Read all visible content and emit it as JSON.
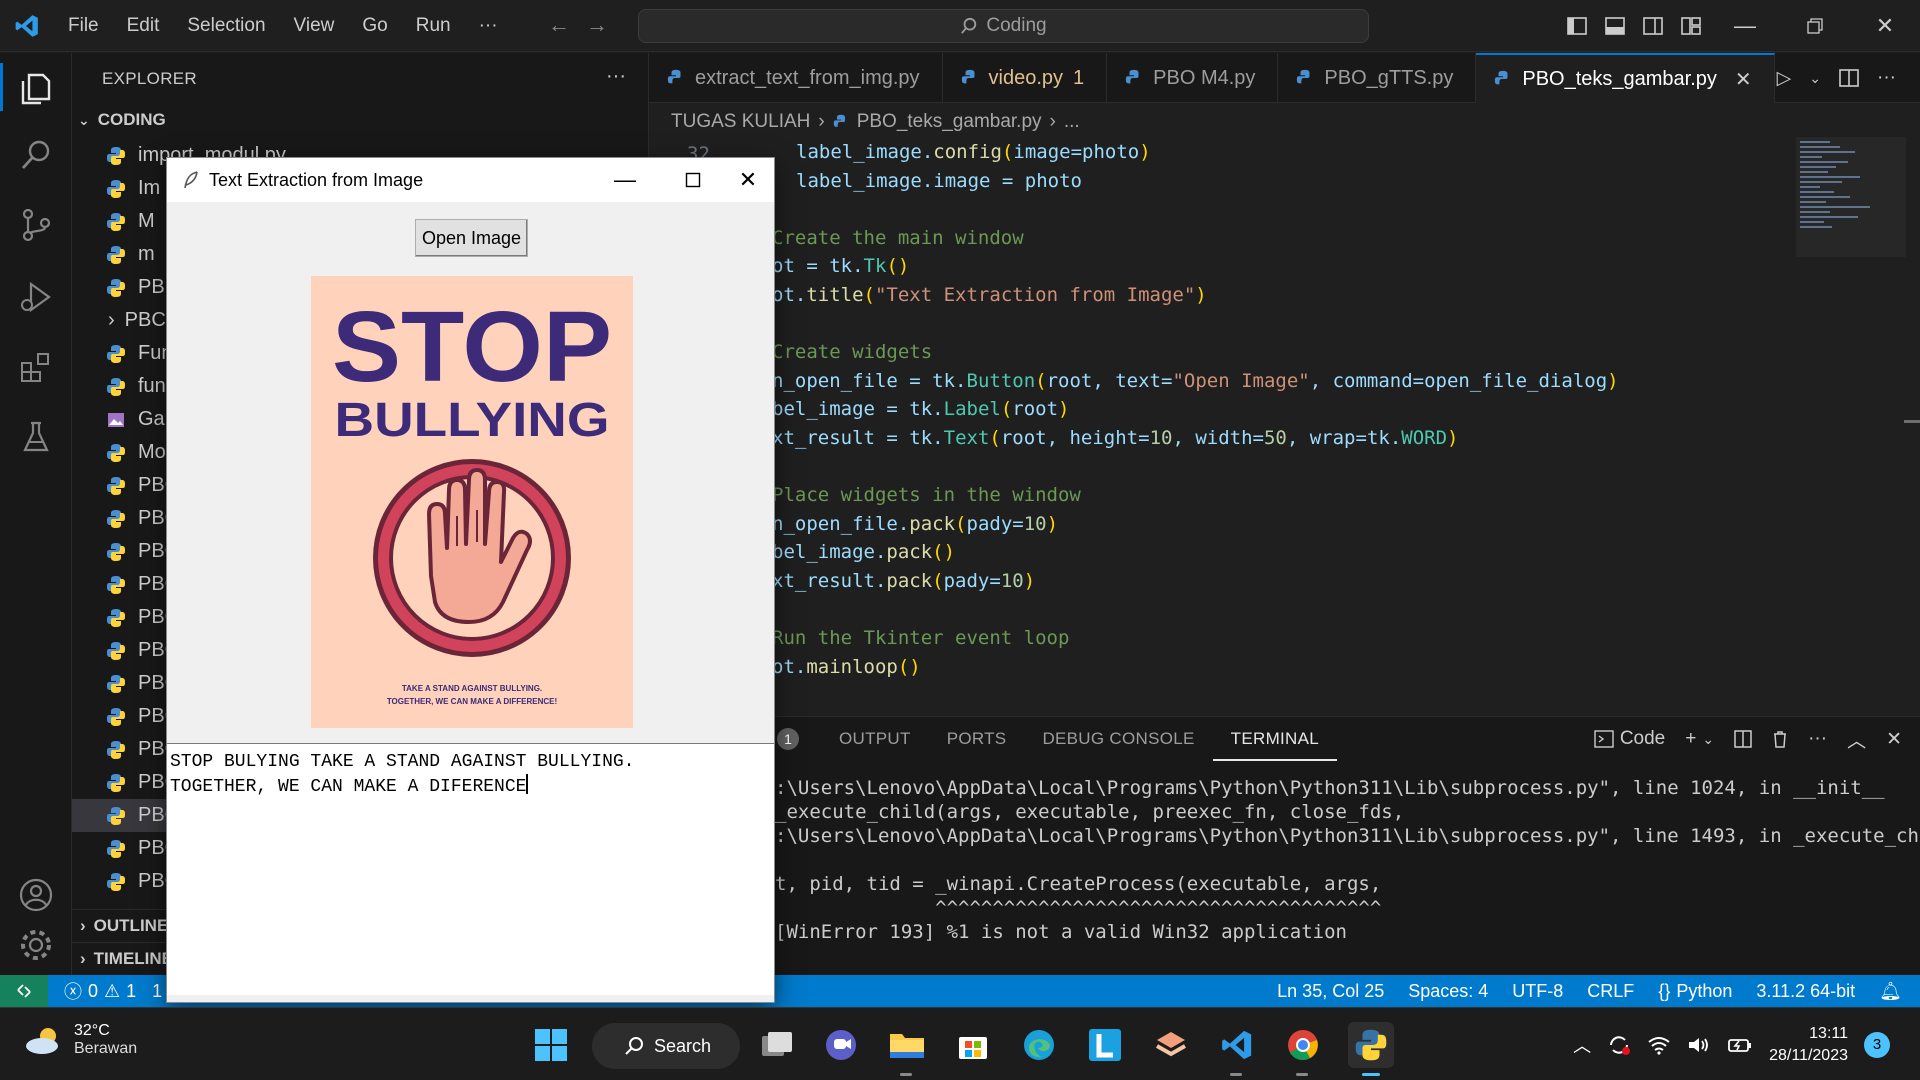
{
  "titlebar": {
    "menu": [
      "File",
      "Edit",
      "Selection",
      "View",
      "Go",
      "Run",
      "···"
    ],
    "search": "Coding"
  },
  "sidebar": {
    "header": "EXPLORER",
    "folder": "CODING",
    "files": [
      "import_modul.py",
      "Im",
      "M",
      "m",
      "PB",
      "PBC",
      "Fun",
      "fung",
      "Gar",
      "Moc",
      "PBC",
      "PBC",
      "PBC",
      "PBC",
      "PBC",
      "PBC",
      "PBC",
      "PBC",
      "PBC",
      "PBC",
      "PBC",
      "PBC",
      "PBC"
    ],
    "sections": [
      "OUTLINE",
      "TIMELINE"
    ]
  },
  "tabs": [
    {
      "label": "extract_text_from_img.py",
      "badge": ""
    },
    {
      "label": "video.py",
      "badge": "1"
    },
    {
      "label": "PBO M4.py",
      "badge": ""
    },
    {
      "label": "PBO_gTTS.py",
      "badge": ""
    },
    {
      "label": "PBO_teks_gambar.py",
      "badge": ""
    }
  ],
  "breadcrumb": {
    "folder": "TUGAS KULIAH",
    "file": "PBO_teks_gambar.py",
    "more": "..."
  },
  "code": {
    "first_line_number": "32",
    "lines": [
      "label_image.config(image=photo)",
      "label_image.image = photo",
      "",
      "Create the main window",
      "ot = tk.Tk()",
      "ot.title(\"Text Extraction from Image\")",
      "",
      "Create widgets",
      "n_open_file = tk.Button(root, text=\"Open Image\", command=open_file_dialog)",
      "bel_image = tk.Label(root)",
      "xt_result = tk.Text(root, height=10, width=50, wrap=tk.WORD)",
      "",
      "Place widgets in the window",
      "n_open_file.pack(pady=10)",
      "bel_image.pack()",
      "xt_result.pack(pady=10)",
      "",
      "Run the Tkinter event loop",
      "ot.mainloop()"
    ]
  },
  "panel": {
    "badge": "1",
    "tabs": [
      "OUTPUT",
      "PORTS",
      "DEBUG CONSOLE",
      "TERMINAL"
    ],
    "shell": "Code",
    "terminal": [
      ":\\Users\\Lenovo\\AppData\\Local\\Programs\\Python\\Python311\\Lib\\subprocess.py\", line 1024, in __init__",
      "_execute_child(args, executable, preexec_fn, close_fds,",
      ":\\Users\\Lenovo\\AppData\\Local\\Programs\\Python\\Python311\\Lib\\subprocess.py\", line 1493, in _execute_chi",
      "",
      "t, pid, tid = _winapi.CreateProcess(executable, args,",
      "              ^^^^^^^^^^^^^^^^^^^^^^^^^^^^^^^^^^^^^^^",
      "[WinError 193] %1 is not a valid Win32 application"
    ]
  },
  "statusbar": {
    "errors": "0",
    "warnings": "1",
    "info": "1",
    "position": "Ln 35, Col 25",
    "spaces": "Spaces: 4",
    "encoding": "UTF-8",
    "eol": "CRLF",
    "language": "Python",
    "interpreter": "3.11.2 64-bit"
  },
  "tkwindow": {
    "title": "Text Extraction from Image",
    "button": "Open Image",
    "poster": {
      "line1": "STOP",
      "line2": "BULLYING",
      "caption1": "TAKE A STAND AGAINST BULLYING.",
      "caption2": "TOGETHER, WE CAN MAKE A DIFFERENCE!"
    },
    "result_line1": "STOP BULYING TAKE A STAND AGAINST BULLYING.",
    "result_line2": "TOGETHER, WE CAN MAKE A DIFERENCE"
  },
  "taskbar": {
    "temperature": "32°C",
    "condition": "Berawan",
    "search": "Search",
    "time": "13:11",
    "date": "28/11/2023",
    "notifications": "3"
  },
  "colors": {
    "accent": "#0078d4",
    "statusbar": "#007acc",
    "poster_bg": "#ffd2bc",
    "poster_text": "#3d2a78",
    "poster_ring": "#d1435b"
  }
}
